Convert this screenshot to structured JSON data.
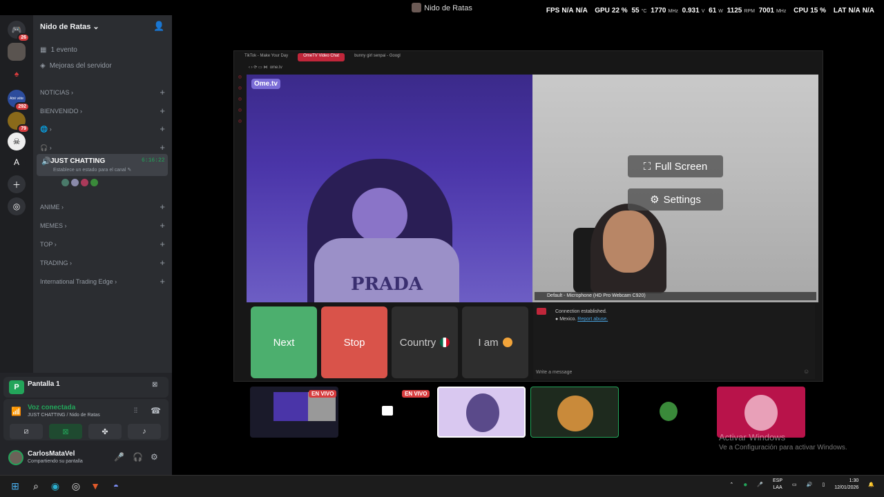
{
  "window": {
    "title": "Nido de Ratas"
  },
  "stats": {
    "fps_label": "FPS",
    "fps_val1": "N/A",
    "fps_val2": "N/A",
    "gpu_label": "GPU",
    "gpu_pct": "22 %",
    "gpu_temp": "55",
    "gpu_temp_unit": "°C",
    "gpu_clock": "1770",
    "gpu_clock_unit": "MHz",
    "gpu_volt": "0.931",
    "gpu_volt_unit": "V",
    "gpu_power": "61",
    "gpu_power_unit": "W",
    "gpu_fan": "1125",
    "gpu_fan_unit": "RPM",
    "mem_clock": "7001",
    "mem_clock_unit": "MHz",
    "cpu_label": "CPU",
    "cpu_pct": "15 %",
    "lat_label": "LAT",
    "lat_val1": "N/A",
    "lat_val2": "N/A"
  },
  "rail": {
    "dm_badge": "26",
    "server_atrevete": "Atré véte",
    "server_atrevete_badge": "292",
    "server_gold_badge": "79",
    "server_a": "A"
  },
  "channels": {
    "server_name": "Nido de Ratas",
    "event": "1 evento",
    "boosts": "Mejoras del servidor",
    "categories": [
      "NOTICIAS",
      "BIENVENIDO",
      "",
      "",
      "ANIME",
      "MEMES",
      "TOP",
      "TRADING",
      "International Trading Edge"
    ],
    "voice_channel": "JUST CHATTING",
    "voice_time": "6:16:22",
    "voice_status": "Establece un estado para el canal"
  },
  "bottom": {
    "screen_label": "Pantalla 1",
    "voice_connected": "Voz conectada",
    "voice_channel_path": "JUST CHATTING / Nido de Ratas",
    "username": "CarlosMataVel",
    "user_status": "Compartiendo su pantalla"
  },
  "browser": {
    "tabs": [
      "TikTok - Make Your Day",
      "OmeTV Video Chat",
      "bunny girl senpai - Googl"
    ],
    "url": "ome.tv",
    "logo": "Ome.tv",
    "shirt_text": "PRADA",
    "full_screen": "Full Screen",
    "settings": "Settings",
    "mic_label": "Default - Microphone (HD Pro Webcam C920)",
    "btn_next": "Next",
    "btn_stop": "Stop",
    "btn_country": "Country",
    "btn_iam": "I am",
    "chat_line1": "Connection established.",
    "chat_line2_country": "Mexico.",
    "chat_line2_link": "Report abuse.",
    "chat_placeholder": "Write a message",
    "colors": {
      "next": "#4caf6e",
      "stop": "#d9534a",
      "neutral": "#2e2e2e"
    }
  },
  "streams": {
    "live_label_1": "EN VIVO",
    "live_label_2": "EN VIVO"
  },
  "activation": {
    "line1": "Activar Windows",
    "line2": "Ve a Configuración para activar Windows."
  },
  "taskbar": {
    "lang1": "ESP",
    "lang2": "LAA",
    "time": "1:30",
    "date": "12/01/2026"
  }
}
